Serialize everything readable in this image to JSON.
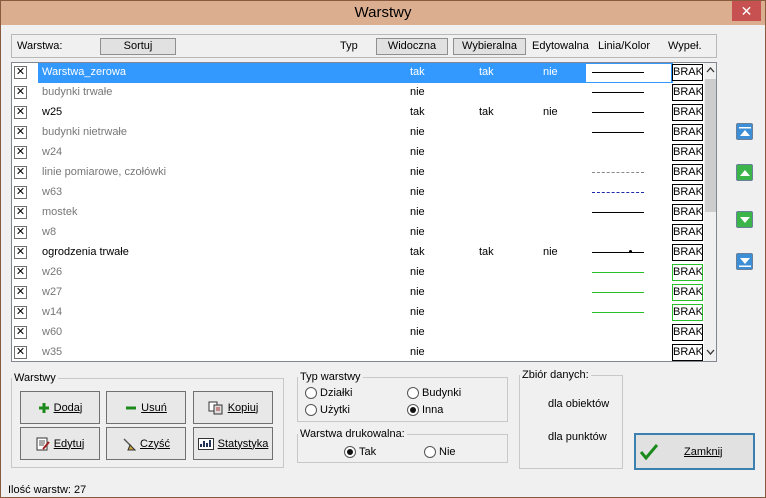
{
  "window": {
    "title": "Warstwy",
    "close_glyph": "✕"
  },
  "header": {
    "warstwa_label": "Warstwa:",
    "sort_button": "Sortuj",
    "typ_label": "Typ",
    "widoczna_button": "Widoczna",
    "wybieralna_button": "Wybieralna",
    "edytowalna_label": "Edytowalna",
    "linia_label": "Linia/Kolor",
    "wypel_label": "Wypeł."
  },
  "layers": [
    {
      "name": "Warstwa_zerowa",
      "visible": "tak",
      "selectable": "tak",
      "editable": "nie",
      "line": "solid-black",
      "fill": "BRAK",
      "selected": true,
      "dim": false
    },
    {
      "name": "budynki trwałe",
      "visible": "nie",
      "selectable": "",
      "editable": "",
      "line": "solid-black",
      "fill": "BRAK",
      "dim": true
    },
    {
      "name": "w25",
      "visible": "tak",
      "selectable": "tak",
      "editable": "nie",
      "line": "solid-black",
      "fill": "BRAK",
      "dim": false
    },
    {
      "name": "budynki nietrwałe",
      "visible": "nie",
      "selectable": "",
      "editable": "",
      "line": "solid-black",
      "fill": "BRAK",
      "dim": true
    },
    {
      "name": "w24",
      "visible": "nie",
      "selectable": "",
      "editable": "",
      "line": "none",
      "fill": "BRAK",
      "dim": true
    },
    {
      "name": "linie pomiarowe, czołówki",
      "visible": "nie",
      "selectable": "",
      "editable": "",
      "line": "dashed-gray",
      "fill": "BRAK",
      "dim": true
    },
    {
      "name": "w63",
      "visible": "nie",
      "selectable": "",
      "editable": "",
      "line": "dashed-blue",
      "fill": "BRAK",
      "dim": true
    },
    {
      "name": "mostek",
      "visible": "nie",
      "selectable": "",
      "editable": "",
      "line": "solid-black",
      "fill": "BRAK",
      "dim": true
    },
    {
      "name": "w8",
      "visible": "nie",
      "selectable": "",
      "editable": "",
      "line": "none",
      "fill": "BRAK",
      "dim": true
    },
    {
      "name": "ogrodzenia trwałe",
      "visible": "tak",
      "selectable": "tak",
      "editable": "nie",
      "line": "dotted-fence",
      "fill": "BRAK",
      "dim": false
    },
    {
      "name": "w26",
      "visible": "nie",
      "selectable": "",
      "editable": "",
      "line": "solid-green",
      "fill": "BRAK",
      "fill_border": "green",
      "dim": true
    },
    {
      "name": "w27",
      "visible": "nie",
      "selectable": "",
      "editable": "",
      "line": "solid-green",
      "fill": "BRAK",
      "fill_border": "green",
      "dim": true
    },
    {
      "name": "w14",
      "visible": "nie",
      "selectable": "",
      "editable": "",
      "line": "solid-green",
      "fill": "BRAK",
      "fill_border": "green",
      "dim": true
    },
    {
      "name": "w60",
      "visible": "nie",
      "selectable": "",
      "editable": "",
      "line": "none",
      "fill": "BRAK",
      "dim": true
    },
    {
      "name": "w35",
      "visible": "nie",
      "selectable": "",
      "editable": "",
      "line": "none",
      "fill": "BRAK",
      "dim": true
    }
  ],
  "checkbox_glyph": "✕",
  "warstwy_group": {
    "legend": "Warstwy",
    "dodaj": "Dodaj",
    "usun": "Usuń",
    "kopiuj": "Kopiuj",
    "edytuj": "Edytuj",
    "czysc": "Czyść",
    "statystyka": "Statystyka"
  },
  "typ_group": {
    "legend": "Typ warstwy",
    "options": [
      "Działki",
      "Budynki",
      "Użytki",
      "Inna"
    ],
    "selected": "Inna"
  },
  "druk_group": {
    "legend": "Warstwa drukowalna:",
    "tak": "Tak",
    "nie": "Nie",
    "selected": "Tak"
  },
  "zbior_group": {
    "legend": "Zbiór danych:",
    "obiekty": "dla obiektów",
    "punkty": "dla punktów"
  },
  "close_button": "Zamknij",
  "status": "Ilość warstw: 27",
  "colors": {
    "titlebar": "#dcae90",
    "selection": "#3399ff",
    "close_red": "#c75050",
    "green_line": "#28c028",
    "dashed_blue": "#1a2aa8"
  }
}
